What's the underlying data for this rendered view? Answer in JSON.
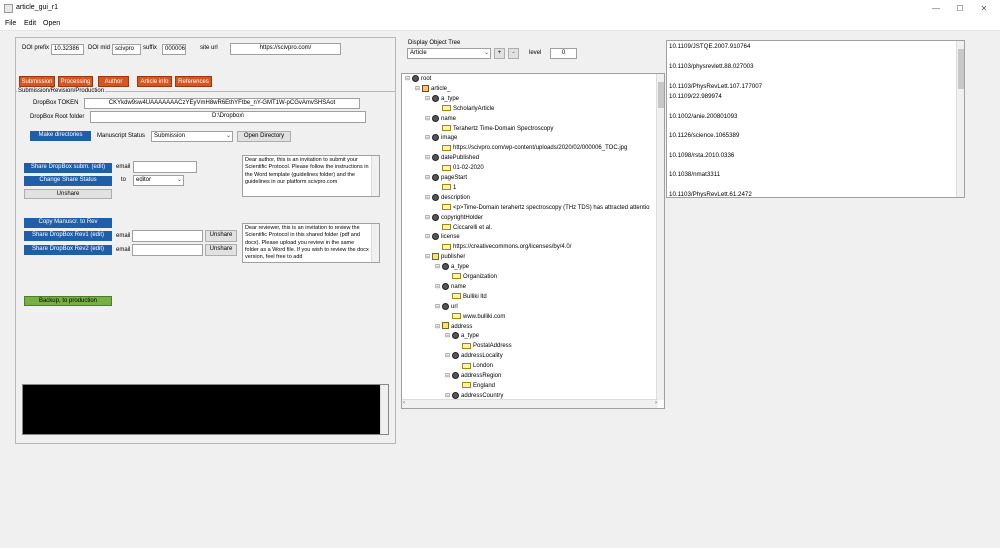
{
  "window": {
    "title": "article_gui_r1",
    "controls": [
      "—",
      "☐",
      "✕"
    ]
  },
  "menu": [
    "File",
    "Edit",
    "Open"
  ],
  "doi": {
    "prefix_label": "DOI prefix",
    "prefix_value": "10.32386",
    "mid_label": "DOI mid",
    "mid_value": "scivpro",
    "suffix_label": "suffix",
    "suffix_value": "000006",
    "site_label": "site url",
    "site_value": "https://scivpro.com/"
  },
  "tabs": [
    "Submission",
    "Processing",
    "Author",
    "Article info",
    "References"
  ],
  "submission_panel": {
    "title": "Submission/Revision/Production",
    "token_label": "DropBox TOKEN",
    "token_value": "CKYkdw9sw4UAAAAAAACzYEyVmH8wR6EthYFtbe_nY-GMT1W-pCGvAmvSHSAot",
    "root_label": "DropBox Root folder",
    "root_value": "D:\\Dropbox\\",
    "make_dirs": "Make directories",
    "status_label": "Manuscript Status",
    "status_value": "Submission",
    "open_dir": "Open Directory",
    "share_submit": "Share DropBox subm. (edit)",
    "change_share": "Change Share Status",
    "unshare": "Unshare",
    "email_label": "email",
    "to_label": "to",
    "role_value": "editor",
    "author_msg": "Dear author, this is an invitation to submit your Scientific Protocol. Please follow the instructions in the Word template (guidelines folder) and the guidelines in our platform scivpro.com",
    "copy_manuscr": "Copy Manuscr. to Rev",
    "share_rev1": "Share DropBox Rev1 (edit)",
    "share_rev2": "Share DropBox Rev2 (edit)",
    "unshare1": "Unshare",
    "unshare2": "Unshare",
    "reviewer_msg": "Dear reviewer, this is an invitation to review the Scientific Protocol in this shared folder (pdf and docx). Please upload you review in the same folder as a Word file. If you wish to review the docx version, feel free to add",
    "backup": "Backup, to production"
  },
  "tree_controls": {
    "title": "Display Object Tree",
    "select_value": "Article",
    "plus": "+",
    "minus": "-",
    "level_label": "level",
    "level_value": "0"
  },
  "tree": [
    {
      "t": "root",
      "lvl": 0,
      "icon": "node",
      "tog": "⊟"
    },
    {
      "t": "article_",
      "lvl": 1,
      "icon": "obj",
      "tog": "⊟"
    },
    {
      "t": "a_type",
      "lvl": 2,
      "icon": "node",
      "tog": "⊟"
    },
    {
      "t": "ScholarlyArticle",
      "lvl": 3,
      "icon": "leaf",
      "tog": ""
    },
    {
      "t": "name",
      "lvl": 2,
      "icon": "node",
      "tog": "⊟"
    },
    {
      "t": "Terahertz Time-Domain Spectroscopy",
      "lvl": 3,
      "icon": "leaf",
      "tog": ""
    },
    {
      "t": "image",
      "lvl": 2,
      "icon": "node",
      "tog": "⊟"
    },
    {
      "t": "https://scivpro.com/wp-content/uploads/2020/02/000006_TOC.jpg",
      "lvl": 3,
      "icon": "leaf",
      "tog": ""
    },
    {
      "t": "datePublished",
      "lvl": 2,
      "icon": "node",
      "tog": "⊟"
    },
    {
      "t": "01-02-2020",
      "lvl": 3,
      "icon": "leaf",
      "tog": ""
    },
    {
      "t": "pageStart",
      "lvl": 2,
      "icon": "node",
      "tog": "⊟"
    },
    {
      "t": "1",
      "lvl": 3,
      "icon": "leaf",
      "tog": ""
    },
    {
      "t": "description",
      "lvl": 2,
      "icon": "node",
      "tog": "⊟"
    },
    {
      "t": "<p>Time-Domain terahertz spectroscopy (THz TDS) has attracted attentio",
      "lvl": 3,
      "icon": "leaf",
      "tog": ""
    },
    {
      "t": "copyrightHolder",
      "lvl": 2,
      "icon": "node",
      "tog": "⊟"
    },
    {
      "t": "Ciccarelli et al.",
      "lvl": 3,
      "icon": "leaf",
      "tog": ""
    },
    {
      "t": "license",
      "lvl": 2,
      "icon": "node",
      "tog": "⊟"
    },
    {
      "t": "https://creativecommons.org/licenses/by/4.0/",
      "lvl": 3,
      "icon": "leaf",
      "tog": ""
    },
    {
      "t": "publisher",
      "lvl": 2,
      "icon": "arr",
      "tog": "⊟"
    },
    {
      "t": "a_type",
      "lvl": 3,
      "icon": "node",
      "tog": "⊟"
    },
    {
      "t": "Organization",
      "lvl": 4,
      "icon": "leaf",
      "tog": ""
    },
    {
      "t": "name",
      "lvl": 3,
      "icon": "node",
      "tog": "⊟"
    },
    {
      "t": "Bulliki ltd",
      "lvl": 4,
      "icon": "leaf",
      "tog": ""
    },
    {
      "t": "url",
      "lvl": 3,
      "icon": "node",
      "tog": "⊟"
    },
    {
      "t": "www.bulliki.com",
      "lvl": 4,
      "icon": "leaf",
      "tog": ""
    },
    {
      "t": "address",
      "lvl": 3,
      "icon": "arr",
      "tog": "⊟"
    },
    {
      "t": "a_type",
      "lvl": 4,
      "icon": "node",
      "tog": "⊟"
    },
    {
      "t": "PostalAddress",
      "lvl": 5,
      "icon": "leaf",
      "tog": ""
    },
    {
      "t": "addressLocality",
      "lvl": 4,
      "icon": "node",
      "tog": "⊟"
    },
    {
      "t": "London",
      "lvl": 5,
      "icon": "leaf",
      "tog": ""
    },
    {
      "t": "addressRegion",
      "lvl": 4,
      "icon": "node",
      "tog": "⊟"
    },
    {
      "t": "England",
      "lvl": 5,
      "icon": "leaf",
      "tog": ""
    },
    {
      "t": "addressCountry",
      "lvl": 4,
      "icon": "node",
      "tog": "⊟"
    }
  ],
  "doi_list": [
    "10.1109/JSTQE.2007.910764",
    "10.1103/physrevlett.88.027003",
    "10.1103/PhysRevLett.107.177007",
    "10.1109/22.989974",
    "10.1002/anie.200801093",
    "10.1126/science.1065389",
    "10.1098/rsta.2010.0336",
    "10.1038/nmat3311",
    "10.1103/PhysRevLett.61.2472"
  ],
  "colors": {
    "tab": "#d9541e",
    "blue_button": "#1f5ea8",
    "green_button": "#76b043"
  }
}
